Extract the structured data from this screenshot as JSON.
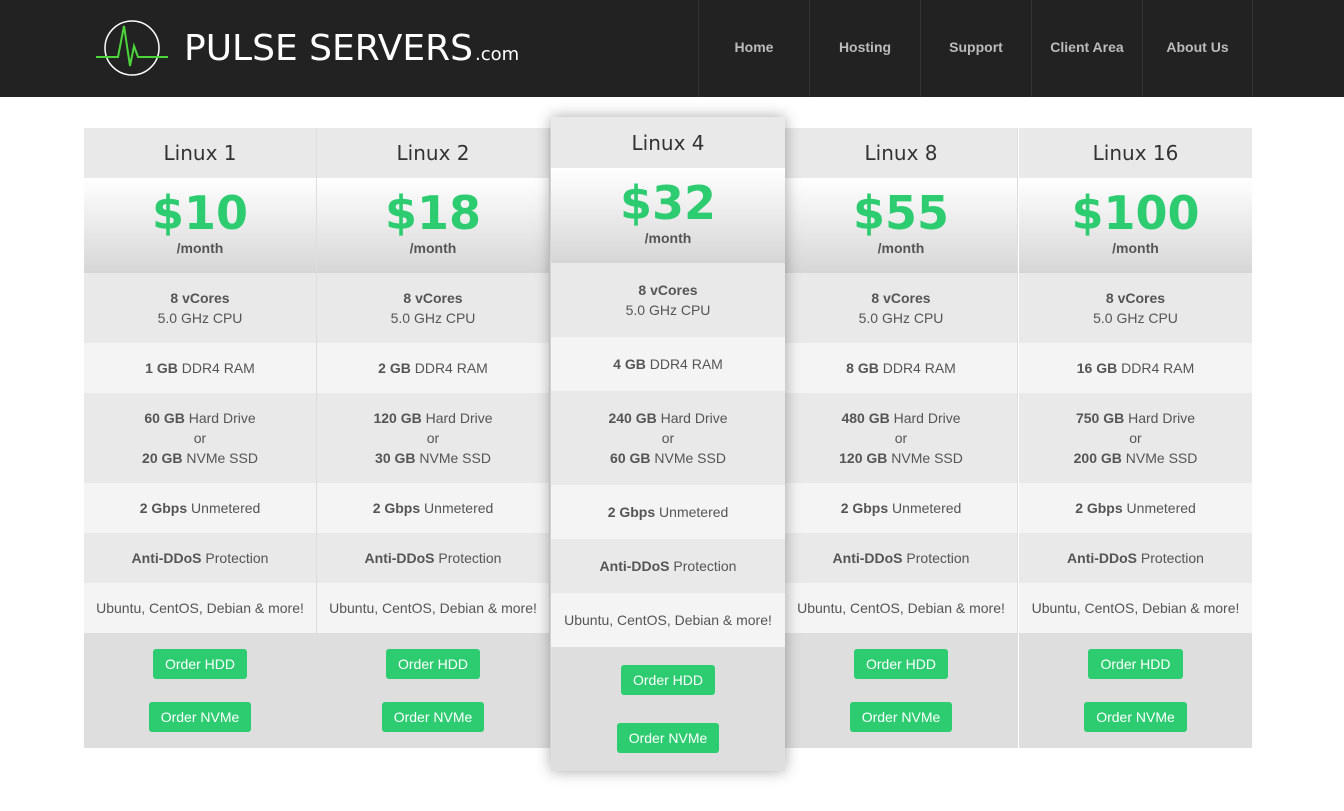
{
  "brand": {
    "name": "PULSE SERVERS",
    "suffix": ".com"
  },
  "nav": [
    "Home",
    "Hosting",
    "Support",
    "Client Area",
    "About Us"
  ],
  "colors": {
    "accent": "#2ecc71",
    "header_bg": "#222222"
  },
  "plans": [
    {
      "name": "Linux 1",
      "price": "$10",
      "period": "/month",
      "cores": "8 vCores",
      "cpu": "5.0 GHz CPU",
      "ram": "1 GB",
      "ram_label": "DDR4 RAM",
      "hdd": "60 GB",
      "hdd_label": "Hard Drive",
      "or": "or",
      "ssd": "20 GB",
      "ssd_label": "NVMe SSD",
      "bw": "2 Gbps",
      "bw_label": "Unmetered",
      "ddos": "Anti-DDoS",
      "ddos_label": "Protection",
      "os": "Ubuntu, CentOS, Debian & more!",
      "order_hdd": "Order HDD",
      "order_nvme": "Order NVMe",
      "featured": false
    },
    {
      "name": "Linux 2",
      "price": "$18",
      "period": "/month",
      "cores": "8 vCores",
      "cpu": "5.0 GHz CPU",
      "ram": "2 GB",
      "ram_label": "DDR4 RAM",
      "hdd": "120 GB",
      "hdd_label": "Hard Drive",
      "or": "or",
      "ssd": "30 GB",
      "ssd_label": "NVMe SSD",
      "bw": "2 Gbps",
      "bw_label": "Unmetered",
      "ddos": "Anti-DDoS",
      "ddos_label": "Protection",
      "os": "Ubuntu, CentOS, Debian & more!",
      "order_hdd": "Order HDD",
      "order_nvme": "Order NVMe",
      "featured": false
    },
    {
      "name": "Linux 4",
      "price": "$32",
      "period": "/month",
      "cores": "8 vCores",
      "cpu": "5.0 GHz CPU",
      "ram": "4 GB",
      "ram_label": "DDR4 RAM",
      "hdd": "240 GB",
      "hdd_label": "Hard Drive",
      "or": "or",
      "ssd": "60 GB",
      "ssd_label": "NVMe SSD",
      "bw": "2 Gbps",
      "bw_label": "Unmetered",
      "ddos": "Anti-DDoS",
      "ddos_label": "Protection",
      "os": "Ubuntu, CentOS, Debian & more!",
      "order_hdd": "Order HDD",
      "order_nvme": "Order NVMe",
      "featured": true
    },
    {
      "name": "Linux 8",
      "price": "$55",
      "period": "/month",
      "cores": "8 vCores",
      "cpu": "5.0 GHz CPU",
      "ram": "8 GB",
      "ram_label": "DDR4 RAM",
      "hdd": "480 GB",
      "hdd_label": "Hard Drive",
      "or": "or",
      "ssd": "120 GB",
      "ssd_label": "NVMe SSD",
      "bw": "2 Gbps",
      "bw_label": "Unmetered",
      "ddos": "Anti-DDoS",
      "ddos_label": "Protection",
      "os": "Ubuntu, CentOS, Debian & more!",
      "order_hdd": "Order HDD",
      "order_nvme": "Order NVMe",
      "featured": false
    },
    {
      "name": "Linux 16",
      "price": "$100",
      "period": "/month",
      "cores": "8 vCores",
      "cpu": "5.0 GHz CPU",
      "ram": "16 GB",
      "ram_label": "DDR4 RAM",
      "hdd": "750 GB",
      "hdd_label": "Hard Drive",
      "or": "or",
      "ssd": "200 GB",
      "ssd_label": "NVMe SSD",
      "bw": "2 Gbps",
      "bw_label": "Unmetered",
      "ddos": "Anti-DDoS",
      "ddos_label": "Protection",
      "os": "Ubuntu, CentOS, Debian & more!",
      "order_hdd": "Order HDD",
      "order_nvme": "Order NVMe",
      "featured": false
    }
  ]
}
